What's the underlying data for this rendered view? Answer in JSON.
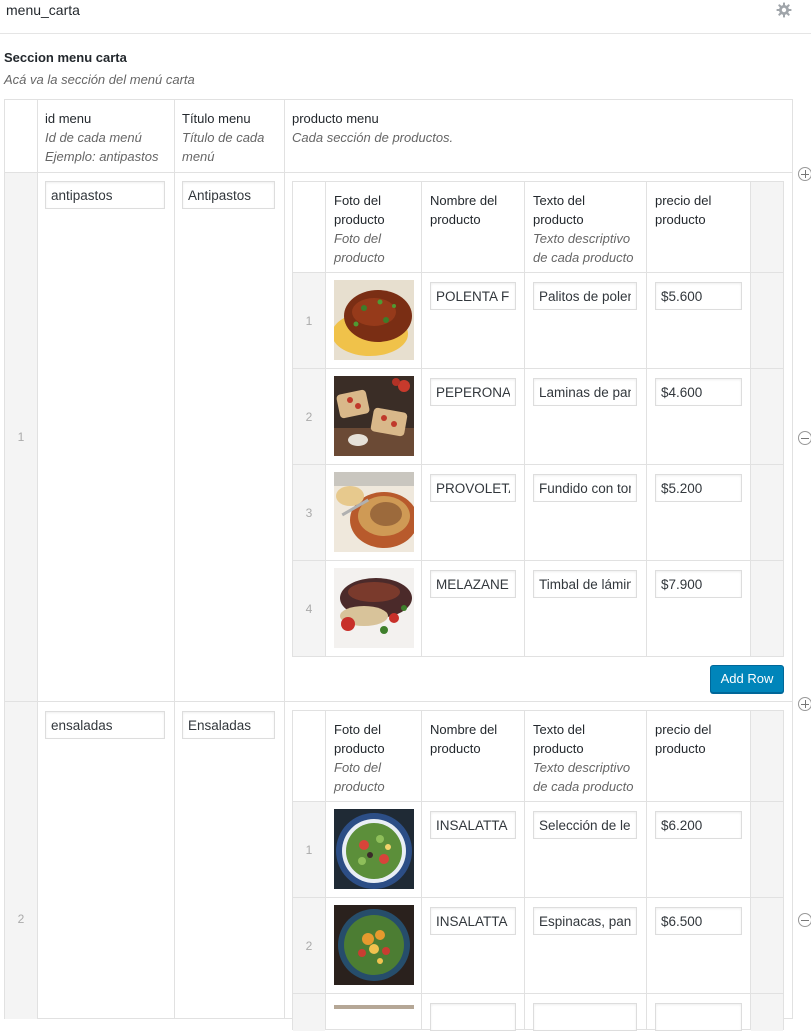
{
  "field": {
    "title": "menu_carta"
  },
  "section": {
    "label": "Seccion menu carta",
    "description": "Acá va la sección del menú carta"
  },
  "columns": {
    "id": {
      "label": "id menu",
      "desc_line1": "Id de cada menú",
      "desc_line2": "Ejemplo: antipastos"
    },
    "titulo": {
      "label": "Título menu",
      "desc_line1": "Título de cada",
      "desc_line2": "menú"
    },
    "producto": {
      "label": "producto menu",
      "desc": "Cada sección de productos."
    }
  },
  "sub_columns": {
    "foto": {
      "label_line1": "Foto del",
      "label_line2": "producto",
      "desc_line1": "Foto del",
      "desc_line2": "producto"
    },
    "nombre": {
      "label_line1": "Nombre del",
      "label_line2": "producto"
    },
    "texto": {
      "label_line1": "Texto del",
      "label_line2": "producto",
      "desc_line1": "Texto descriptivo",
      "desc_line2": "de cada producto"
    },
    "precio": {
      "label_line1": "precio del",
      "label_line2": "producto"
    }
  },
  "add_row_label": "Add Row",
  "rows": [
    {
      "num": "1",
      "id": "antipastos",
      "titulo": "Antipastos",
      "products": [
        {
          "num": "1",
          "nombre": "POLENTA FRITA",
          "texto": "Palitos de polenta",
          "precio": "$5.600",
          "image": "polenta-dish"
        },
        {
          "num": "2",
          "nombre": "PEPERONATA",
          "texto": "Laminas de pan",
          "precio": "$4.600",
          "image": "bruschetta-dish"
        },
        {
          "num": "3",
          "nombre": "PROVOLETA",
          "texto": "Fundido con tomate",
          "precio": "$5.200",
          "image": "provoleta-dish"
        },
        {
          "num": "4",
          "nombre": "MELAZANE",
          "texto": "Timbal de láminas",
          "precio": "$7.900",
          "image": "eggplant-dish"
        }
      ]
    },
    {
      "num": "2",
      "id": "ensaladas",
      "titulo": "Ensaladas",
      "products": [
        {
          "num": "1",
          "nombre": "INSALATTA DI",
          "texto": "Selección de lechugas",
          "precio": "$6.200",
          "image": "salad-bowl"
        },
        {
          "num": "2",
          "nombre": "INSALATTA DI",
          "texto": "Espinacas, panceta",
          "precio": "$6.500",
          "image": "spinach-salad"
        }
      ]
    }
  ]
}
